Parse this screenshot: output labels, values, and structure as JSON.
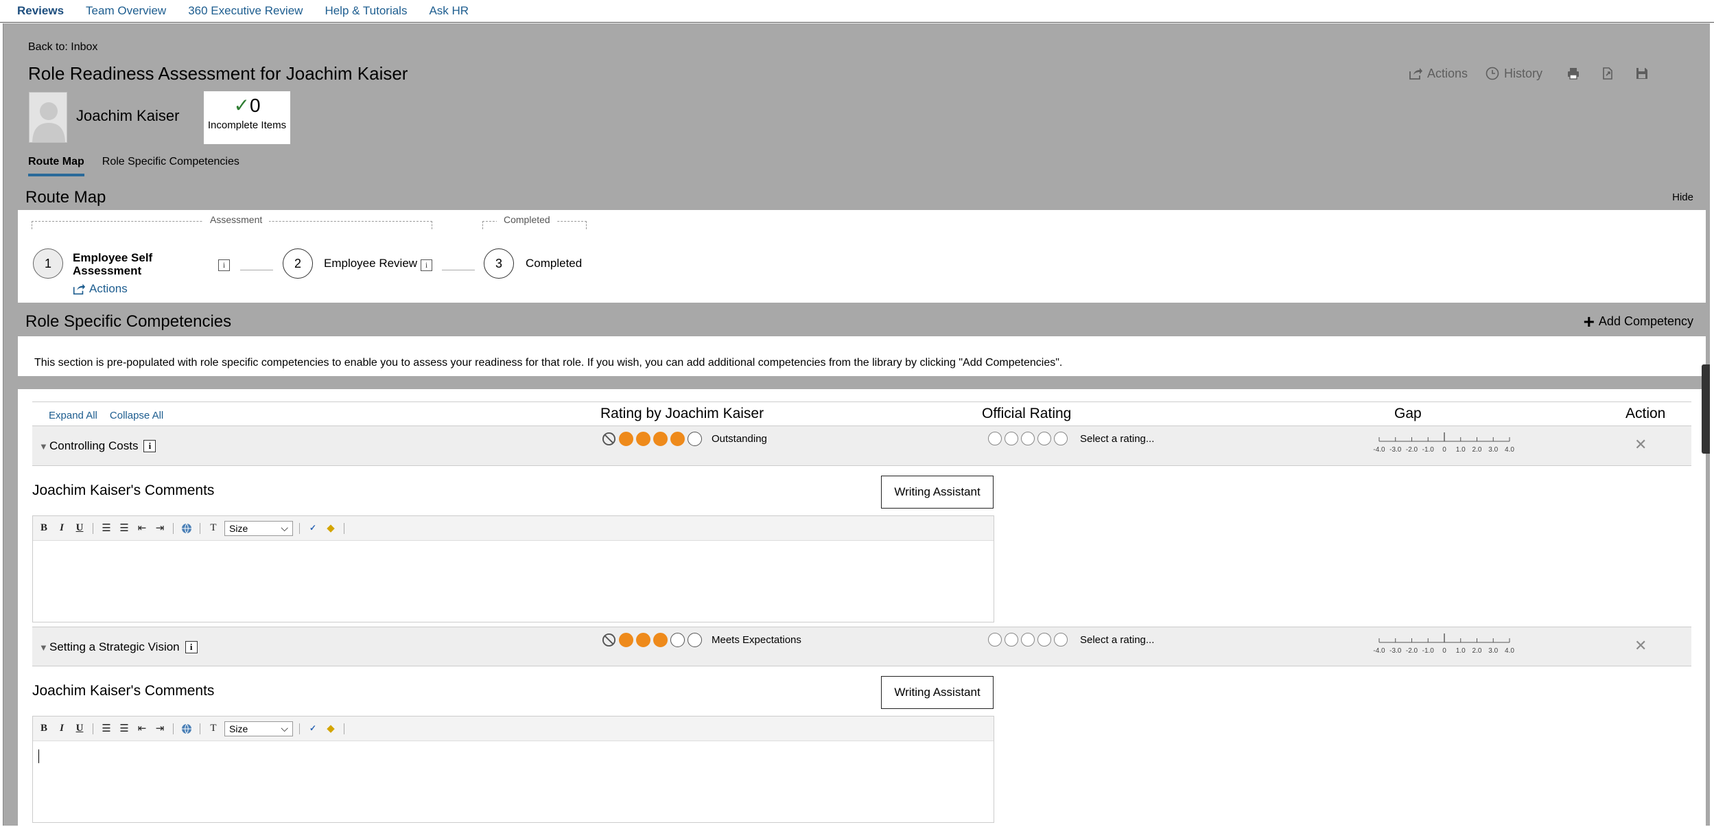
{
  "nav": {
    "items": [
      "Reviews",
      "Team Overview",
      "360 Executive Review",
      "Help & Tutorials",
      "Ask HR"
    ],
    "active_index": 0
  },
  "header": {
    "back_label": "Back to: Inbox",
    "title": "Role Readiness Assessment for Joachim Kaiser",
    "employee_name": "Joachim Kaiser",
    "incomplete_count": "0",
    "incomplete_label": "Incomplete Items"
  },
  "toolbar": {
    "actions_label": "Actions",
    "history_label": "History"
  },
  "subtabs": [
    "Route Map",
    "Role Specific Competencies"
  ],
  "routemap": {
    "title": "Route Map",
    "hide_label": "Hide",
    "bracket_assessment": "Assessment",
    "bracket_completed": "Completed",
    "steps": [
      {
        "num": "1",
        "label": "Employee Self Assessment"
      },
      {
        "num": "2",
        "label": "Employee Review"
      },
      {
        "num": "3",
        "label": "Completed"
      }
    ],
    "actions_label": "Actions"
  },
  "competencies": {
    "title": "Role Specific Competencies",
    "add_label": "Add Competency",
    "intro": "This section is pre-populated with role specific competencies to enable you to assess your readiness for that role.  If you wish, you can add additional competencies from the library by clicking \"Add Competencies\".",
    "expand_all": "Expand All",
    "collapse_all": "Collapse All",
    "col_rating": "Rating by Joachim Kaiser",
    "col_official": "Official Rating",
    "col_gap": "Gap",
    "col_action": "Action",
    "official_placeholder": "Select a rating...",
    "comments_title": "Joachim Kaiser's Comments",
    "writing_assistant": "Writing Assistant",
    "size_label": "Size",
    "gap_ticks": [
      "-4.0",
      "-3.0",
      "-2.0",
      "-1.0",
      "0",
      "1.0",
      "2.0",
      "3.0",
      "4.0"
    ],
    "rows": [
      {
        "name": "Controlling Costs",
        "rating": 4,
        "rating_max": 5,
        "rating_text": "Outstanding"
      },
      {
        "name": "Setting a Strategic Vision",
        "rating": 3,
        "rating_max": 5,
        "rating_text": "Meets Expectations"
      }
    ]
  },
  "colors": {
    "accent": "#1d5d8f",
    "rating_on": "#ee8a1b",
    "background_gray": "#a8a8a8"
  }
}
